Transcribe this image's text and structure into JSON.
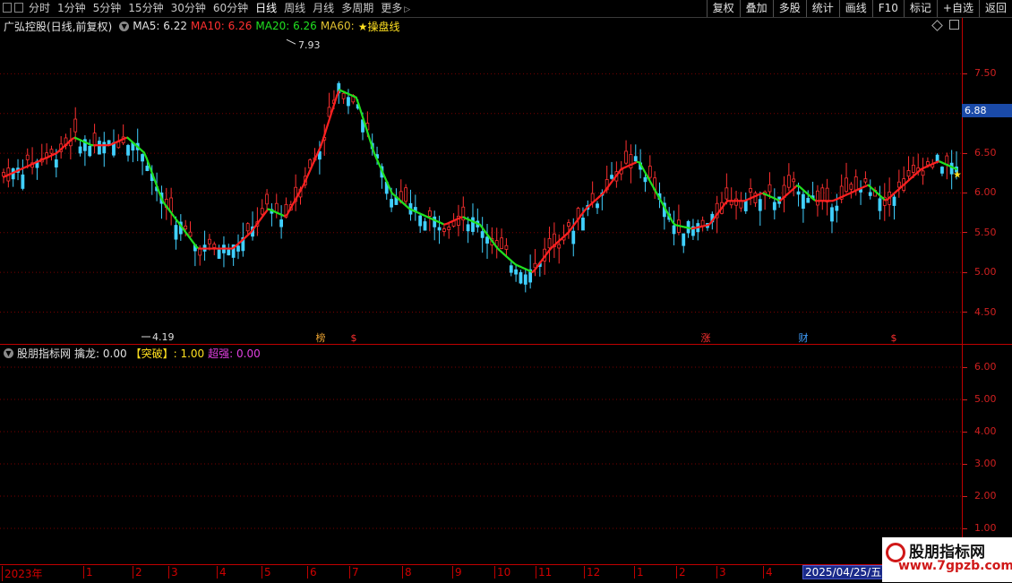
{
  "toolbar": {
    "tabs": [
      "分时",
      "1分钟",
      "5分钟",
      "15分钟",
      "30分钟",
      "60分钟",
      "日线",
      "周线",
      "月线",
      "多周期",
      "更多"
    ],
    "active_tab": "日线",
    "right_buttons": [
      "复权",
      "叠加",
      "多股",
      "统计",
      "画线",
      "F10",
      "标记",
      "+自选",
      "返回"
    ]
  },
  "main_panel": {
    "title": "广弘控股(日线,前复权)",
    "ma5_label": "MA5: 6.22",
    "ma10_label": "MA10: 6.26",
    "ma20_label": "MA20: 6.26",
    "ma60_label": "MA60:",
    "indicator_label": "★操盘线",
    "high_label": "7.93",
    "low_label": "4.19",
    "current_price": "6.88",
    "y_ticks": [
      "7.50",
      "7.00",
      "6.50",
      "6.00",
      "5.50",
      "5.00",
      "4.50"
    ],
    "markers": [
      {
        "text": "榜",
        "color": "#e8a030"
      },
      {
        "text": "$",
        "color": "#ff3030"
      },
      {
        "text": "涨",
        "color": "#ff3030"
      },
      {
        "text": "财",
        "color": "#40a0ff"
      },
      {
        "text": "$",
        "color": "#ff3030"
      }
    ]
  },
  "sub_panel": {
    "title": "股朋指标网",
    "l1": "擒龙: 0.00",
    "l2": "【突破】: 1.00",
    "l3": "超强: 0.00",
    "y_ticks": [
      "6.00",
      "5.00",
      "4.00",
      "3.00",
      "2.00",
      "1.00"
    ]
  },
  "date_axis": {
    "months": [
      "2023年",
      "1",
      "2",
      "3",
      "4",
      "5",
      "6",
      "7",
      "8",
      "9",
      "10",
      "11",
      "12",
      "1",
      "2",
      "3",
      "4"
    ],
    "current_date": "2025/04/25/五"
  },
  "watermark": {
    "name": "股朋指标网",
    "url": "www.7gpzb.com"
  },
  "colors": {
    "up": "#ff3030",
    "down": "#40d0ff",
    "ma_up": "#ff2020",
    "ma_down": "#20e020",
    "grid": "#7a0000"
  },
  "chart_data": {
    "type": "line",
    "title": "广弘控股(日线,前复权)",
    "ylim": [
      4.1,
      8.0
    ],
    "series": [
      {
        "name": "★操盘线",
        "values": [
          6.2,
          6.3,
          6.4,
          6.5,
          6.7,
          6.6,
          6.6,
          6.7,
          6.5,
          5.9,
          5.6,
          5.3,
          5.3,
          5.3,
          5.5,
          5.8,
          5.7,
          6.1,
          6.6,
          7.3,
          7.2,
          6.5,
          6.0,
          5.8,
          5.7,
          5.6,
          5.7,
          5.6,
          5.3,
          5.1,
          5.0,
          5.3,
          5.5,
          5.8,
          6.0,
          6.3,
          6.4,
          6.0,
          5.6,
          5.55,
          5.6,
          5.9,
          5.9,
          6.0,
          5.9,
          6.1,
          5.9,
          5.9,
          6.0,
          6.1,
          5.9,
          6.1,
          6.3,
          6.4,
          6.3
        ]
      }
    ],
    "high": 7.93,
    "low": 4.19
  }
}
